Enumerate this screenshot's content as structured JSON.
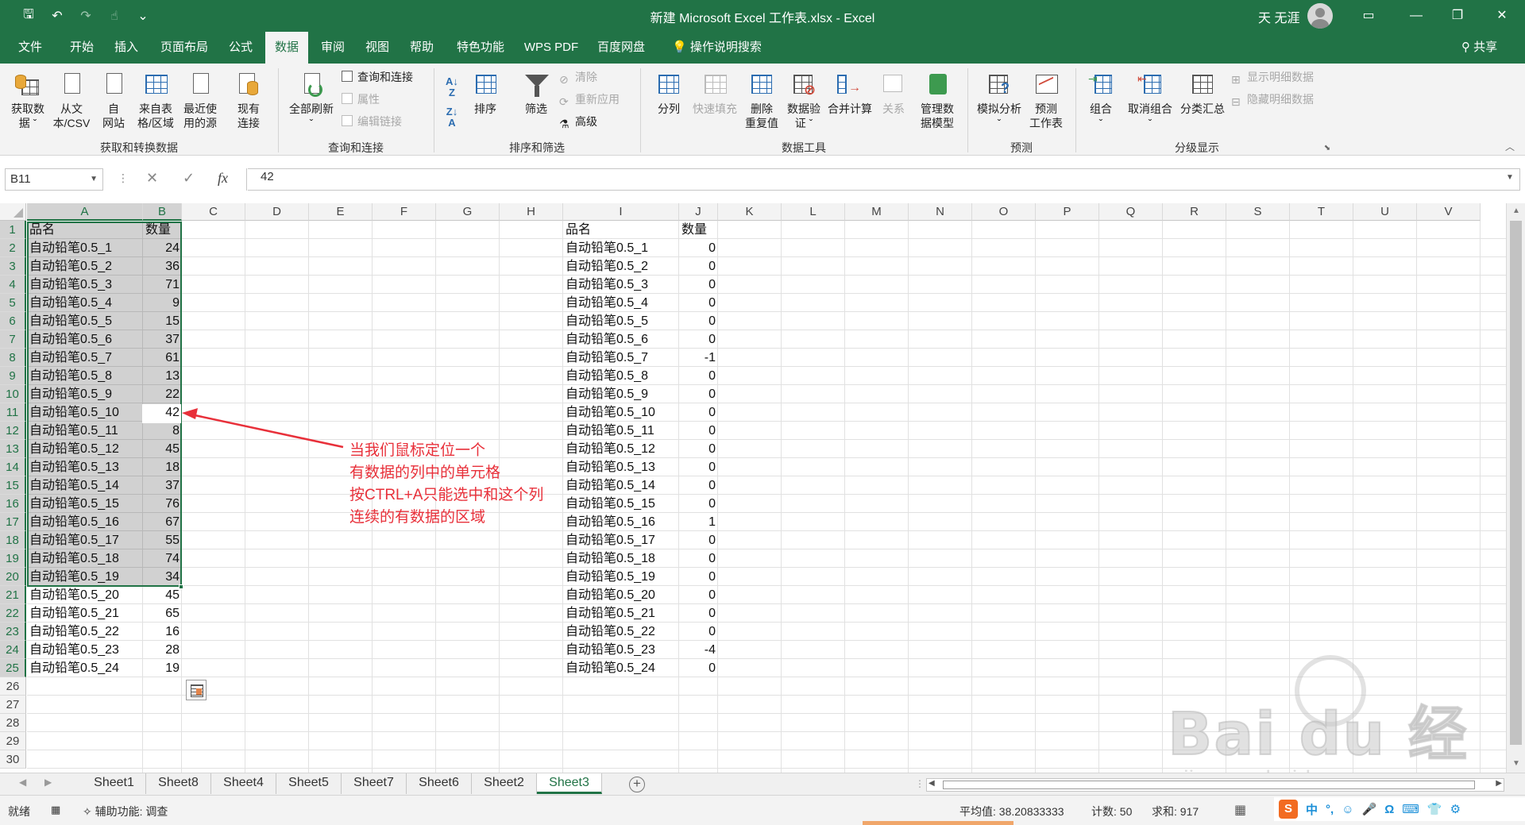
{
  "window": {
    "title": "新建 Microsoft Excel 工作表.xlsx  -  Excel",
    "user": "天 无涯",
    "brand_color": "#217346"
  },
  "qat": [
    "save-icon",
    "undo-icon",
    "redo-icon",
    "touch-mode-icon",
    "customize-icon"
  ],
  "tabs": [
    "文件",
    "开始",
    "插入",
    "页面布局",
    "公式",
    "数据",
    "审阅",
    "视图",
    "帮助",
    "特色功能",
    "WPS PDF",
    "百度网盘"
  ],
  "active_tab": "数据",
  "tell_me": "操作说明搜索",
  "share": "共享",
  "ribbon": {
    "groups": {
      "get": "获取和转换数据",
      "query": "查询和连接",
      "sort": "排序和筛选",
      "tools": "数据工具",
      "forecast": "预测",
      "outline": "分级显示"
    },
    "get_data": [
      "获取数",
      "据 ˇ"
    ],
    "from_csv": [
      "从文",
      "本/CSV"
    ],
    "from_web": [
      "自",
      "网站"
    ],
    "from_table": [
      "来自表",
      "格/区域"
    ],
    "recent": [
      "最近使",
      "用的源"
    ],
    "existing": [
      "现有",
      "连接"
    ],
    "refresh_all": [
      "全部刷新",
      "ˇ"
    ],
    "queries": "查询和连接",
    "properties": "属性",
    "edit_links": "编辑链接",
    "sort": "排序",
    "filter": "筛选",
    "clear": "清除",
    "reapply": "重新应用",
    "advanced": "高级",
    "split": "分列",
    "flash_fill": "快速填充",
    "remove_dup": [
      "删除",
      "重复值"
    ],
    "validation": [
      "数据验",
      "证 ˇ"
    ],
    "consolidate": "合并计算",
    "relations": "关系",
    "data_model": [
      "管理数",
      "据模型"
    ],
    "whatif": [
      "模拟分析",
      "ˇ"
    ],
    "forecast_sheet": [
      "预测",
      "工作表"
    ],
    "group": [
      "组合",
      "ˇ"
    ],
    "ungroup": [
      "取消组合",
      "ˇ"
    ],
    "subtotal": "分类汇总",
    "show_detail": "显示明细数据",
    "hide_detail": "隐藏明细数据"
  },
  "formula_bar": {
    "name_box": "B11",
    "fx": "fx",
    "content": "42"
  },
  "columns": [
    "A",
    "B",
    "C",
    "D",
    "E",
    "F",
    "G",
    "H",
    "I",
    "J",
    "K",
    "L",
    "M",
    "N",
    "O",
    "P",
    "Q",
    "R",
    "S",
    "T",
    "U",
    "V"
  ],
  "rows": [
    "1",
    "2",
    "3",
    "4",
    "5",
    "6",
    "7",
    "8",
    "9",
    "10",
    "11",
    "12",
    "13",
    "14",
    "15",
    "16",
    "17",
    "18",
    "19",
    "20",
    "21",
    "22",
    "23",
    "24",
    "25",
    "26",
    "27",
    "28",
    "29",
    "30"
  ],
  "table_left": {
    "headers": [
      "品名",
      "数量"
    ],
    "rows": [
      [
        "自动铅笔0.5_1",
        "24"
      ],
      [
        "自动铅笔0.5_2",
        "36"
      ],
      [
        "自动铅笔0.5_3",
        "71"
      ],
      [
        "自动铅笔0.5_4",
        "9"
      ],
      [
        "自动铅笔0.5_5",
        "15"
      ],
      [
        "自动铅笔0.5_6",
        "37"
      ],
      [
        "自动铅笔0.5_7",
        "61"
      ],
      [
        "自动铅笔0.5_8",
        "13"
      ],
      [
        "自动铅笔0.5_9",
        "22"
      ],
      [
        "自动铅笔0.5_10",
        "42"
      ],
      [
        "自动铅笔0.5_11",
        "8"
      ],
      [
        "自动铅笔0.5_12",
        "45"
      ],
      [
        "自动铅笔0.5_13",
        "18"
      ],
      [
        "自动铅笔0.5_14",
        "37"
      ],
      [
        "自动铅笔0.5_15",
        "76"
      ],
      [
        "自动铅笔0.5_16",
        "67"
      ],
      [
        "自动铅笔0.5_17",
        "55"
      ],
      [
        "自动铅笔0.5_18",
        "74"
      ],
      [
        "自动铅笔0.5_19",
        "34"
      ],
      [
        "自动铅笔0.5_20",
        "45"
      ],
      [
        "自动铅笔0.5_21",
        "65"
      ],
      [
        "自动铅笔0.5_22",
        "16"
      ],
      [
        "自动铅笔0.5_23",
        "28"
      ],
      [
        "自动铅笔0.5_24",
        "19"
      ]
    ]
  },
  "table_right": {
    "headers": [
      "品名",
      "数量"
    ],
    "rows": [
      [
        "自动铅笔0.5_1",
        "0"
      ],
      [
        "自动铅笔0.5_2",
        "0"
      ],
      [
        "自动铅笔0.5_3",
        "0"
      ],
      [
        "自动铅笔0.5_4",
        "0"
      ],
      [
        "自动铅笔0.5_5",
        "0"
      ],
      [
        "自动铅笔0.5_6",
        "0"
      ],
      [
        "自动铅笔0.5_7",
        "-1"
      ],
      [
        "自动铅笔0.5_8",
        "0"
      ],
      [
        "自动铅笔0.5_9",
        "0"
      ],
      [
        "自动铅笔0.5_10",
        "0"
      ],
      [
        "自动铅笔0.5_11",
        "0"
      ],
      [
        "自动铅笔0.5_12",
        "0"
      ],
      [
        "自动铅笔0.5_13",
        "0"
      ],
      [
        "自动铅笔0.5_14",
        "0"
      ],
      [
        "自动铅笔0.5_15",
        "0"
      ],
      [
        "自动铅笔0.5_16",
        "1"
      ],
      [
        "自动铅笔0.5_17",
        "0"
      ],
      [
        "自动铅笔0.5_18",
        "0"
      ],
      [
        "自动铅笔0.5_19",
        "0"
      ],
      [
        "自动铅笔0.5_20",
        "0"
      ],
      [
        "自动铅笔0.5_21",
        "0"
      ],
      [
        "自动铅笔0.5_22",
        "0"
      ],
      [
        "自动铅笔0.5_23",
        "-4"
      ],
      [
        "自动铅笔0.5_24",
        "0"
      ]
    ]
  },
  "annotation": {
    "lines": [
      "当我们鼠标定位一个",
      "有数据的列中的单元格",
      "按CTRL+A只能选中和这个列",
      "连续的有数据的区域"
    ],
    "color": "#e8303a"
  },
  "sheets": [
    "Sheet1",
    "Sheet8",
    "Sheet4",
    "Sheet5",
    "Sheet7",
    "Sheet6",
    "Sheet2",
    "Sheet3"
  ],
  "active_sheet": "Sheet3",
  "status": {
    "ready": "就绪",
    "accessibility": "辅助功能: 调查",
    "average": "平均值: 38.20833333",
    "count": "计数: 50",
    "sum": "求和: 917"
  },
  "ime": [
    "中",
    "°,",
    "☺",
    "🎤",
    "Ω",
    "⌨",
    "👕",
    "⚙"
  ],
  "watermark": {
    "logo": "Bai du 经验",
    "url": "jingyan.baidu.com"
  }
}
